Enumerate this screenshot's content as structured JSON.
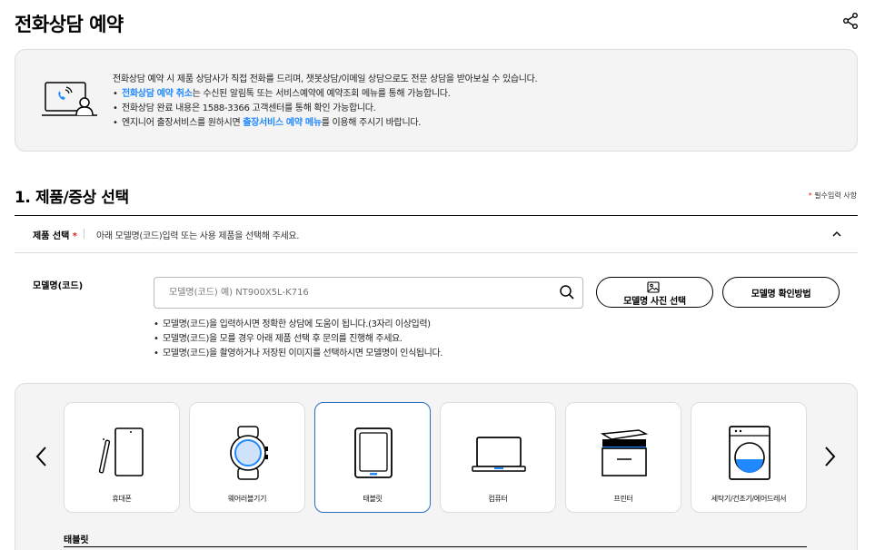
{
  "page": {
    "title": "전화상담 예약"
  },
  "info": {
    "line1": "전화상담 예약 시 제품 상담사가 직접 전화를 드리며, 챗봇상담/이메일 상담으로도 전문 상담을 받아보실 수 있습니다.",
    "line2_link": "전화상담 예약 취소",
    "line2_rest": "는 수신된 알림톡 또는 서비스예약에 예약조회 메뉴를 통해 가능합니다.",
    "line3": "전화상담 완료 내용은 1588-3366 고객센터를 통해 확인 가능합니다.",
    "line4_pre": "엔지니어 출장서비스를 원하시면 ",
    "line4_link": "출장서비스 예약 메뉴",
    "line4_post": "를 이용해 주시기 바랍니다."
  },
  "section": {
    "title": "1. 제품/증상 선택",
    "required_star": "*",
    "required_note": " 필수입력 사항"
  },
  "product_select": {
    "label": "제품 선택",
    "star": "*",
    "desc": "아래 모델명(코드)입력 또는 사용 제품을 선택해 주세요."
  },
  "model": {
    "label": "모델명(코드)",
    "placeholder": "모델명(코드) 예) NT900X5L-K716",
    "value": "",
    "photo_button": "모델명 사진 선택",
    "howto_button": "모델명 확인방법",
    "tips": [
      "모델명(코드)을 입력하시면 정확한 상담에 도움이 됩니다.(3자리 이상입력)",
      "모델명(코드)을 모를 경우 아래 제품 선택 후 문의를 진행해 주세요.",
      "모델명(코드)을 촬영하거나 저장된 이미지를 선택하시면 모델명이 인식됩니다."
    ]
  },
  "categories": [
    {
      "label": "휴대폰",
      "icon": "phone-icon"
    },
    {
      "label": "웨어러블기기",
      "icon": "watch-icon"
    },
    {
      "label": "태블릿",
      "icon": "tablet-icon",
      "selected": true
    },
    {
      "label": "컴퓨터",
      "icon": "laptop-icon"
    },
    {
      "label": "프린터",
      "icon": "printer-icon"
    },
    {
      "label": "세탁기/건조기/에어드레서",
      "icon": "washer-icon"
    }
  ],
  "subcategory": {
    "title": "태블릿"
  },
  "colors": {
    "link": "#2189ff",
    "required": "#e2231a",
    "selected_border": "#2a6ebb",
    "accent": "#2189ff"
  }
}
